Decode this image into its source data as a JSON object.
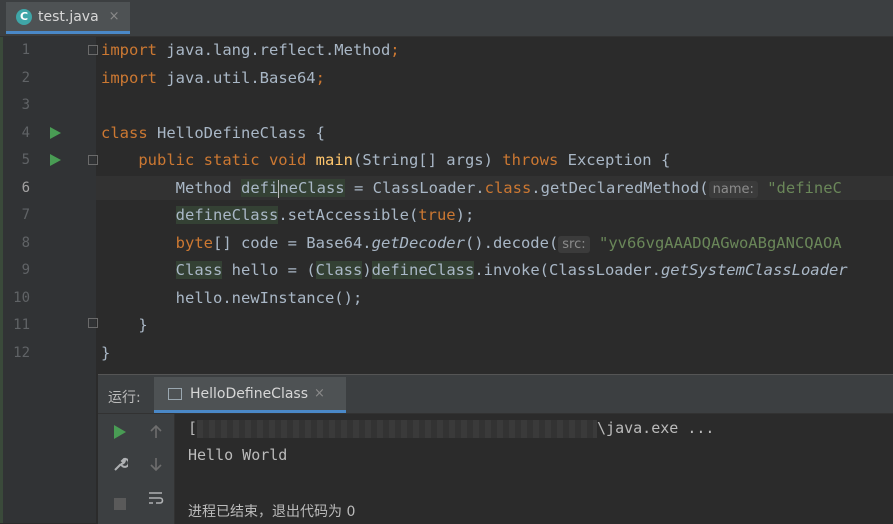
{
  "tab": {
    "icon": "c-class-icon",
    "filename": "test.java",
    "close": "×"
  },
  "line_numbers": [
    "1",
    "2",
    "3",
    "4",
    "5",
    "6",
    "7",
    "8",
    "9",
    "10",
    "11",
    "12"
  ],
  "code": {
    "l1": {
      "kw": "import",
      "rest": " java.lang.reflect.Method",
      "semi": ";"
    },
    "l2": {
      "kw": "import",
      "rest": " java.util.Base64",
      "semi": ";"
    },
    "l4": {
      "kw": "class",
      "rest": " HelloDefineClass {"
    },
    "l5": {
      "kw1": "public static void",
      "fn": "main",
      "p1": "(String[] args) ",
      "kw2": "throws",
      "p2": " Exception {"
    },
    "l6": {
      "a": "Method ",
      "b": "defineClass",
      "c": " = ClassLoader.",
      "d": "class",
      "e": ".getDeclaredMethod(",
      "hint": "name:",
      "str": "\"defineC"
    },
    "l7": {
      "a": "defineClass",
      "b": ".setAccessible(",
      "kw": "true",
      "c": ");"
    },
    "l8": {
      "kw": "byte",
      "a": "[] code = Base64.",
      "it": "getDecoder",
      "b": "().decode(",
      "hint": "src:",
      "str": "\"yv66vgAAADQAGwoABgANCQAOA"
    },
    "l9": {
      "a": "Class",
      "b": " hello = (",
      "c": "Class",
      "d": ")",
      "e": "defineClass",
      "f": ".invoke(ClassLoader.",
      "it": "getSystemClassLoader"
    },
    "l10": {
      "a": "hello.newInstance();"
    },
    "l11": {
      "a": "}"
    },
    "l12": {
      "a": "}"
    }
  },
  "run": {
    "label": "运行:",
    "tab_name": "HelloDefineClass",
    "tab_close": "×",
    "output": {
      "cmd_prefix": "[",
      "cmd_suffix": "\\java.exe ...",
      "line2": "Hello World",
      "line4": "进程已结束，退出代码为 0"
    }
  }
}
